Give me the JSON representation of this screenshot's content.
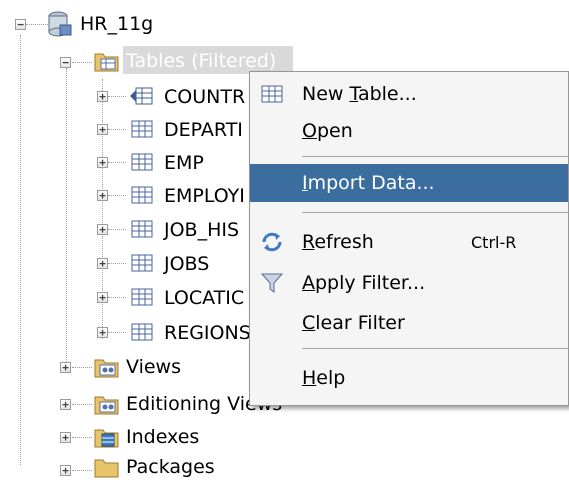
{
  "tree": {
    "root": {
      "label": "HR_11g",
      "expander": "−",
      "icon": "database-connection-icon"
    },
    "tables": {
      "label": "Tables (Filtered)",
      "expander": "−",
      "icon": "tables-folder-icon"
    },
    "table_items": [
      {
        "label": "COUNTR",
        "expander": "+",
        "icon": "table-link-icon"
      },
      {
        "label": "DEPARTI",
        "expander": "+",
        "icon": "table-icon"
      },
      {
        "label": "EMP",
        "expander": "+",
        "icon": "table-icon"
      },
      {
        "label": "EMPLOYI",
        "expander": "+",
        "icon": "table-icon"
      },
      {
        "label": "JOB_HIS",
        "expander": "+",
        "icon": "table-icon"
      },
      {
        "label": "JOBS",
        "expander": "+",
        "icon": "table-icon"
      },
      {
        "label": "LOCATIC",
        "expander": "+",
        "icon": "table-icon"
      },
      {
        "label": "REGIONS",
        "expander": "+",
        "icon": "table-icon"
      }
    ],
    "folders": [
      {
        "label": "Views",
        "expander": "+",
        "icon": "views-folder-icon"
      },
      {
        "label": "Editioning Views",
        "expander": "+",
        "icon": "editioning-views-folder-icon"
      },
      {
        "label": "Indexes",
        "expander": "+",
        "icon": "indexes-folder-icon"
      },
      {
        "label": "Packages",
        "expander": "+",
        "icon": "packages-folder-icon"
      }
    ]
  },
  "context_menu": {
    "items": [
      {
        "pre": "New ",
        "u": "T",
        "post": "able...",
        "icon": "new-table-icon",
        "shortcut": ""
      },
      {
        "pre": "",
        "u": "O",
        "post": "pen",
        "icon": "",
        "shortcut": ""
      },
      {
        "pre": "",
        "u": "I",
        "post": "mport Data...",
        "icon": "",
        "shortcut": "",
        "highlighted": true
      },
      {
        "pre": "",
        "u": "R",
        "post": "efresh",
        "icon": "refresh-icon",
        "shortcut": "Ctrl-R"
      },
      {
        "pre": "",
        "u": "A",
        "post": "pply Filter...",
        "icon": "filter-icon",
        "shortcut": ""
      },
      {
        "pre": "",
        "u": "C",
        "post": "lear Filter",
        "icon": "",
        "shortcut": ""
      },
      {
        "pre": "",
        "u": "H",
        "post": "elp",
        "icon": "",
        "shortcut": ""
      }
    ],
    "highlight_color": "#3b6e9e"
  }
}
